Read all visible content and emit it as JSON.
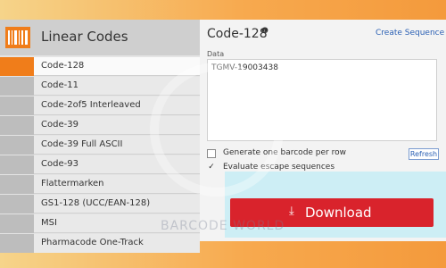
{
  "sidebar": {
    "title": "Linear Codes",
    "items": [
      {
        "label": "Code-128"
      },
      {
        "label": "Code-11"
      },
      {
        "label": "Code-2of5 Interleaved"
      },
      {
        "label": "Code-39"
      },
      {
        "label": "Code-39 Full ASCII"
      },
      {
        "label": "Code-93"
      },
      {
        "label": "Flattermarken"
      },
      {
        "label": "GS1-128 (UCC/EAN-128)"
      },
      {
        "label": "MSI"
      },
      {
        "label": "Pharmacode One-Track"
      }
    ]
  },
  "main": {
    "title": "Code-128",
    "info_icon": "❶",
    "create_sequence": "Create Sequence",
    "data_label": "Data",
    "data_value": "TGMV-19003438",
    "option_per_row": "Generate one barcode per row",
    "option_escape": "Evaluate escape sequences",
    "escape_checked_mark": "✓",
    "refresh_label": "Refresh",
    "download_label": "Download",
    "download_icon": "⤓"
  },
  "watermark": "BARCODE WORLD",
  "colors": {
    "accent": "#f07d1a",
    "download": "#d9232c",
    "link": "#2b60b4"
  }
}
